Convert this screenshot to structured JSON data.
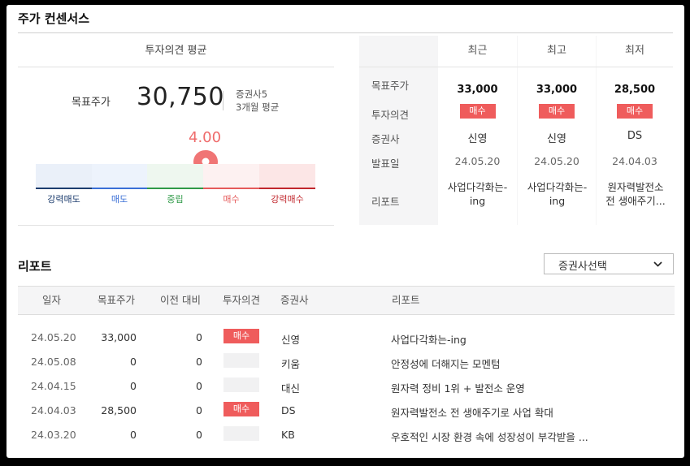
{
  "section_title": "주가 컨센서스",
  "consensus": {
    "header": "투자의견 평균",
    "target_label": "목표주가",
    "target_value": "30,750",
    "brokers": "증권사5",
    "period": "3개월 평균",
    "score": "4.00",
    "score_position_fraction": 0.6,
    "scale": [
      "강력매도",
      "매도",
      "중립",
      "매수",
      "강력매수"
    ],
    "scale_colors": [
      "#1d3d6e",
      "#3a6fd6",
      "#2f9a47",
      "#e55b5b",
      "#c1272d"
    ]
  },
  "summary": {
    "columns": [
      "최근",
      "최고",
      "최저"
    ],
    "row_labels": [
      "목표주가",
      "투자의견",
      "증권사",
      "발표일",
      "리포트"
    ],
    "cols": [
      {
        "target": "33,000",
        "opinion": "매수",
        "broker": "신영",
        "date": "24.05.20",
        "report": "사업다각화는-ing"
      },
      {
        "target": "33,000",
        "opinion": "매수",
        "broker": "신영",
        "date": "24.05.20",
        "report": "사업다각화는-ing"
      },
      {
        "target": "28,500",
        "opinion": "매수",
        "broker": "DS",
        "date": "24.04.03",
        "report": "원자력발전소 전 생애주기..."
      }
    ]
  },
  "reports": {
    "title": "리포트",
    "dropdown_label": "증권사선택",
    "headers": [
      "일자",
      "목표주가",
      "이전 대비",
      "투자의견",
      "증권사",
      "리포트"
    ],
    "rows": [
      {
        "date": "24.05.20",
        "target": "33,000",
        "change": "0",
        "opinion": "매수",
        "broker": "신영",
        "report": "사업다각화는-ing"
      },
      {
        "date": "24.05.08",
        "target": "0",
        "change": "0",
        "opinion": "",
        "broker": "키움",
        "report": "안정성에 더해지는 모멘텀"
      },
      {
        "date": "24.04.15",
        "target": "0",
        "change": "0",
        "opinion": "",
        "broker": "대신",
        "report": "원자력 정비 1위 + 발전소 운영"
      },
      {
        "date": "24.04.03",
        "target": "28,500",
        "change": "0",
        "opinion": "매수",
        "broker": "DS",
        "report": "원자력발전소 전 생애주기로 사업 확대"
      },
      {
        "date": "24.03.20",
        "target": "0",
        "change": "0",
        "opinion": "",
        "broker": "KB",
        "report": "우호적인 시장 환경 속에 성장성이 부각받을 ..."
      }
    ]
  }
}
